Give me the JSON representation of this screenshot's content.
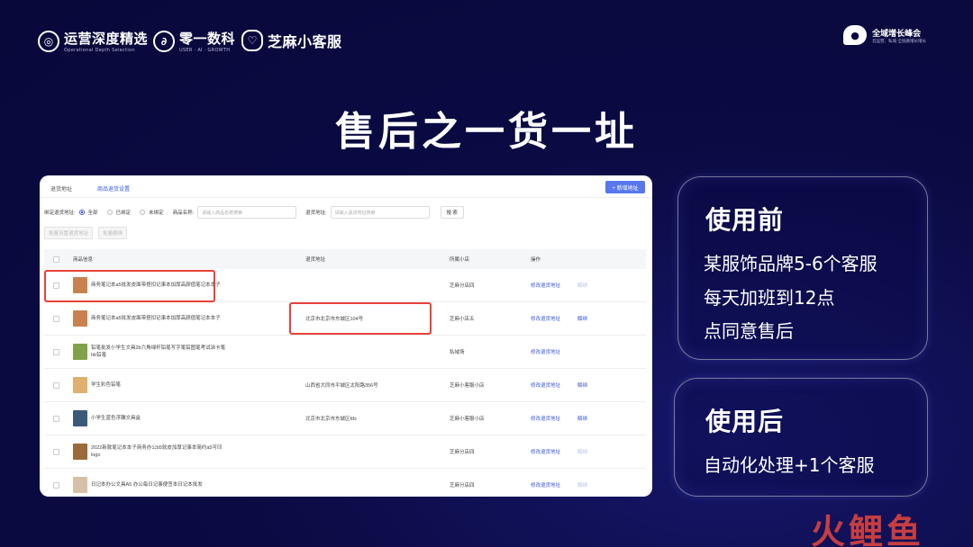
{
  "header": {
    "logo1": {
      "name": "运营深度精选",
      "sub": "Operational Depth Selection"
    },
    "cross": "×",
    "logo2": {
      "name": "零一数科",
      "sub": "USER · AI · GROWTH"
    },
    "logo3": {
      "name": "芝麻小客服"
    },
    "summit": {
      "title": "全域增长峰会",
      "sub": "云运营、私域·全链路增长增长"
    }
  },
  "title": "售后之一货一址",
  "screenshot": {
    "tabs": [
      "退货地址",
      "商品退货设置"
    ],
    "active_tab": 1,
    "add_button": "+ 新增地址",
    "filter": {
      "bind_label": "绑定退货地址:",
      "options": [
        "全部",
        "已绑定",
        "未绑定"
      ],
      "selected": "全部",
      "product_label": "商品名称:",
      "product_placeholder": "请输入商品名称搜索",
      "address_label": "退货地址:",
      "address_placeholder": "请输入退货地址搜索",
      "search": "搜 索"
    },
    "batch_buttons": [
      "批量设置退货地址",
      "批量解绑"
    ],
    "columns": [
      "商品信息",
      "退货地址",
      "所属小店",
      "操作"
    ],
    "rows": [
      {
        "name": "商务笔记本a5批发皮面带搭扣记事本加厚高颜值笔记本本子",
        "address": "",
        "shop": "芝麻分店四",
        "op1": "修改退货地址",
        "op2": "解绑",
        "thumb": "#c9824f",
        "unbind_active": false
      },
      {
        "name": "商务笔记本a5批发皮面带搭扣记事本加厚高颜值笔记本本子",
        "address": "北京市北京市东城区104号",
        "shop": "芝麻小店五",
        "op1": "修改退货地址",
        "op2": "解绑",
        "thumb": "#c9824f",
        "unbind_active": true
      },
      {
        "name": "铅笔批发小学生文具2b六角绿杆铅笔写字笔铅图笔考试涂卡笔hb铅笔",
        "address": "",
        "shop": "私域场",
        "op1": "修改退货地址",
        "op2": "",
        "thumb": "#7fa34a",
        "unbind_active": false
      },
      {
        "name": "学生彩色铅笔",
        "address": "山西省大同市平城区太阳路356号",
        "shop": "芝麻小客服小店",
        "op1": "修改退货地址",
        "op2": "解绑",
        "thumb": "#e0b070",
        "unbind_active": true
      },
      {
        "name": "小学生蓝色浮雕文具盒",
        "address": "北京市北京市东城区fds",
        "shop": "芝麻小客服小店",
        "op1": "修改退货地址",
        "op2": "解绑",
        "thumb": "#3a5a7a",
        "unbind_active": true
      },
      {
        "name": "2022新款笔记本本子商务办公b5软皮加厚记事本简约a5可印logo",
        "address": "",
        "shop": "芝麻分店四",
        "op1": "修改退货地址",
        "op2": "解绑",
        "thumb": "#9a6a3a",
        "unbind_active": false
      },
      {
        "name": "日记本办公文具A5 办公每日记事便签本日记本批发",
        "address": "",
        "shop": "芝麻分店四",
        "op1": "修改退货地址",
        "op2": "解绑",
        "thumb": "#d8c0a8",
        "unbind_active": false
      }
    ]
  },
  "before": {
    "title": "使用前",
    "lines": [
      "某服饰品牌5-6个客服",
      "每天加班到12点",
      "点同意售后"
    ]
  },
  "after": {
    "title": "使用后",
    "lines": [
      "自动化处理+1个客服"
    ]
  },
  "watermark": "火鲤鱼",
  "colors": {
    "background": "#0b0b45",
    "accent": "#3a56e0",
    "highlight": "#e7423a",
    "watermark": "#e6463c"
  }
}
